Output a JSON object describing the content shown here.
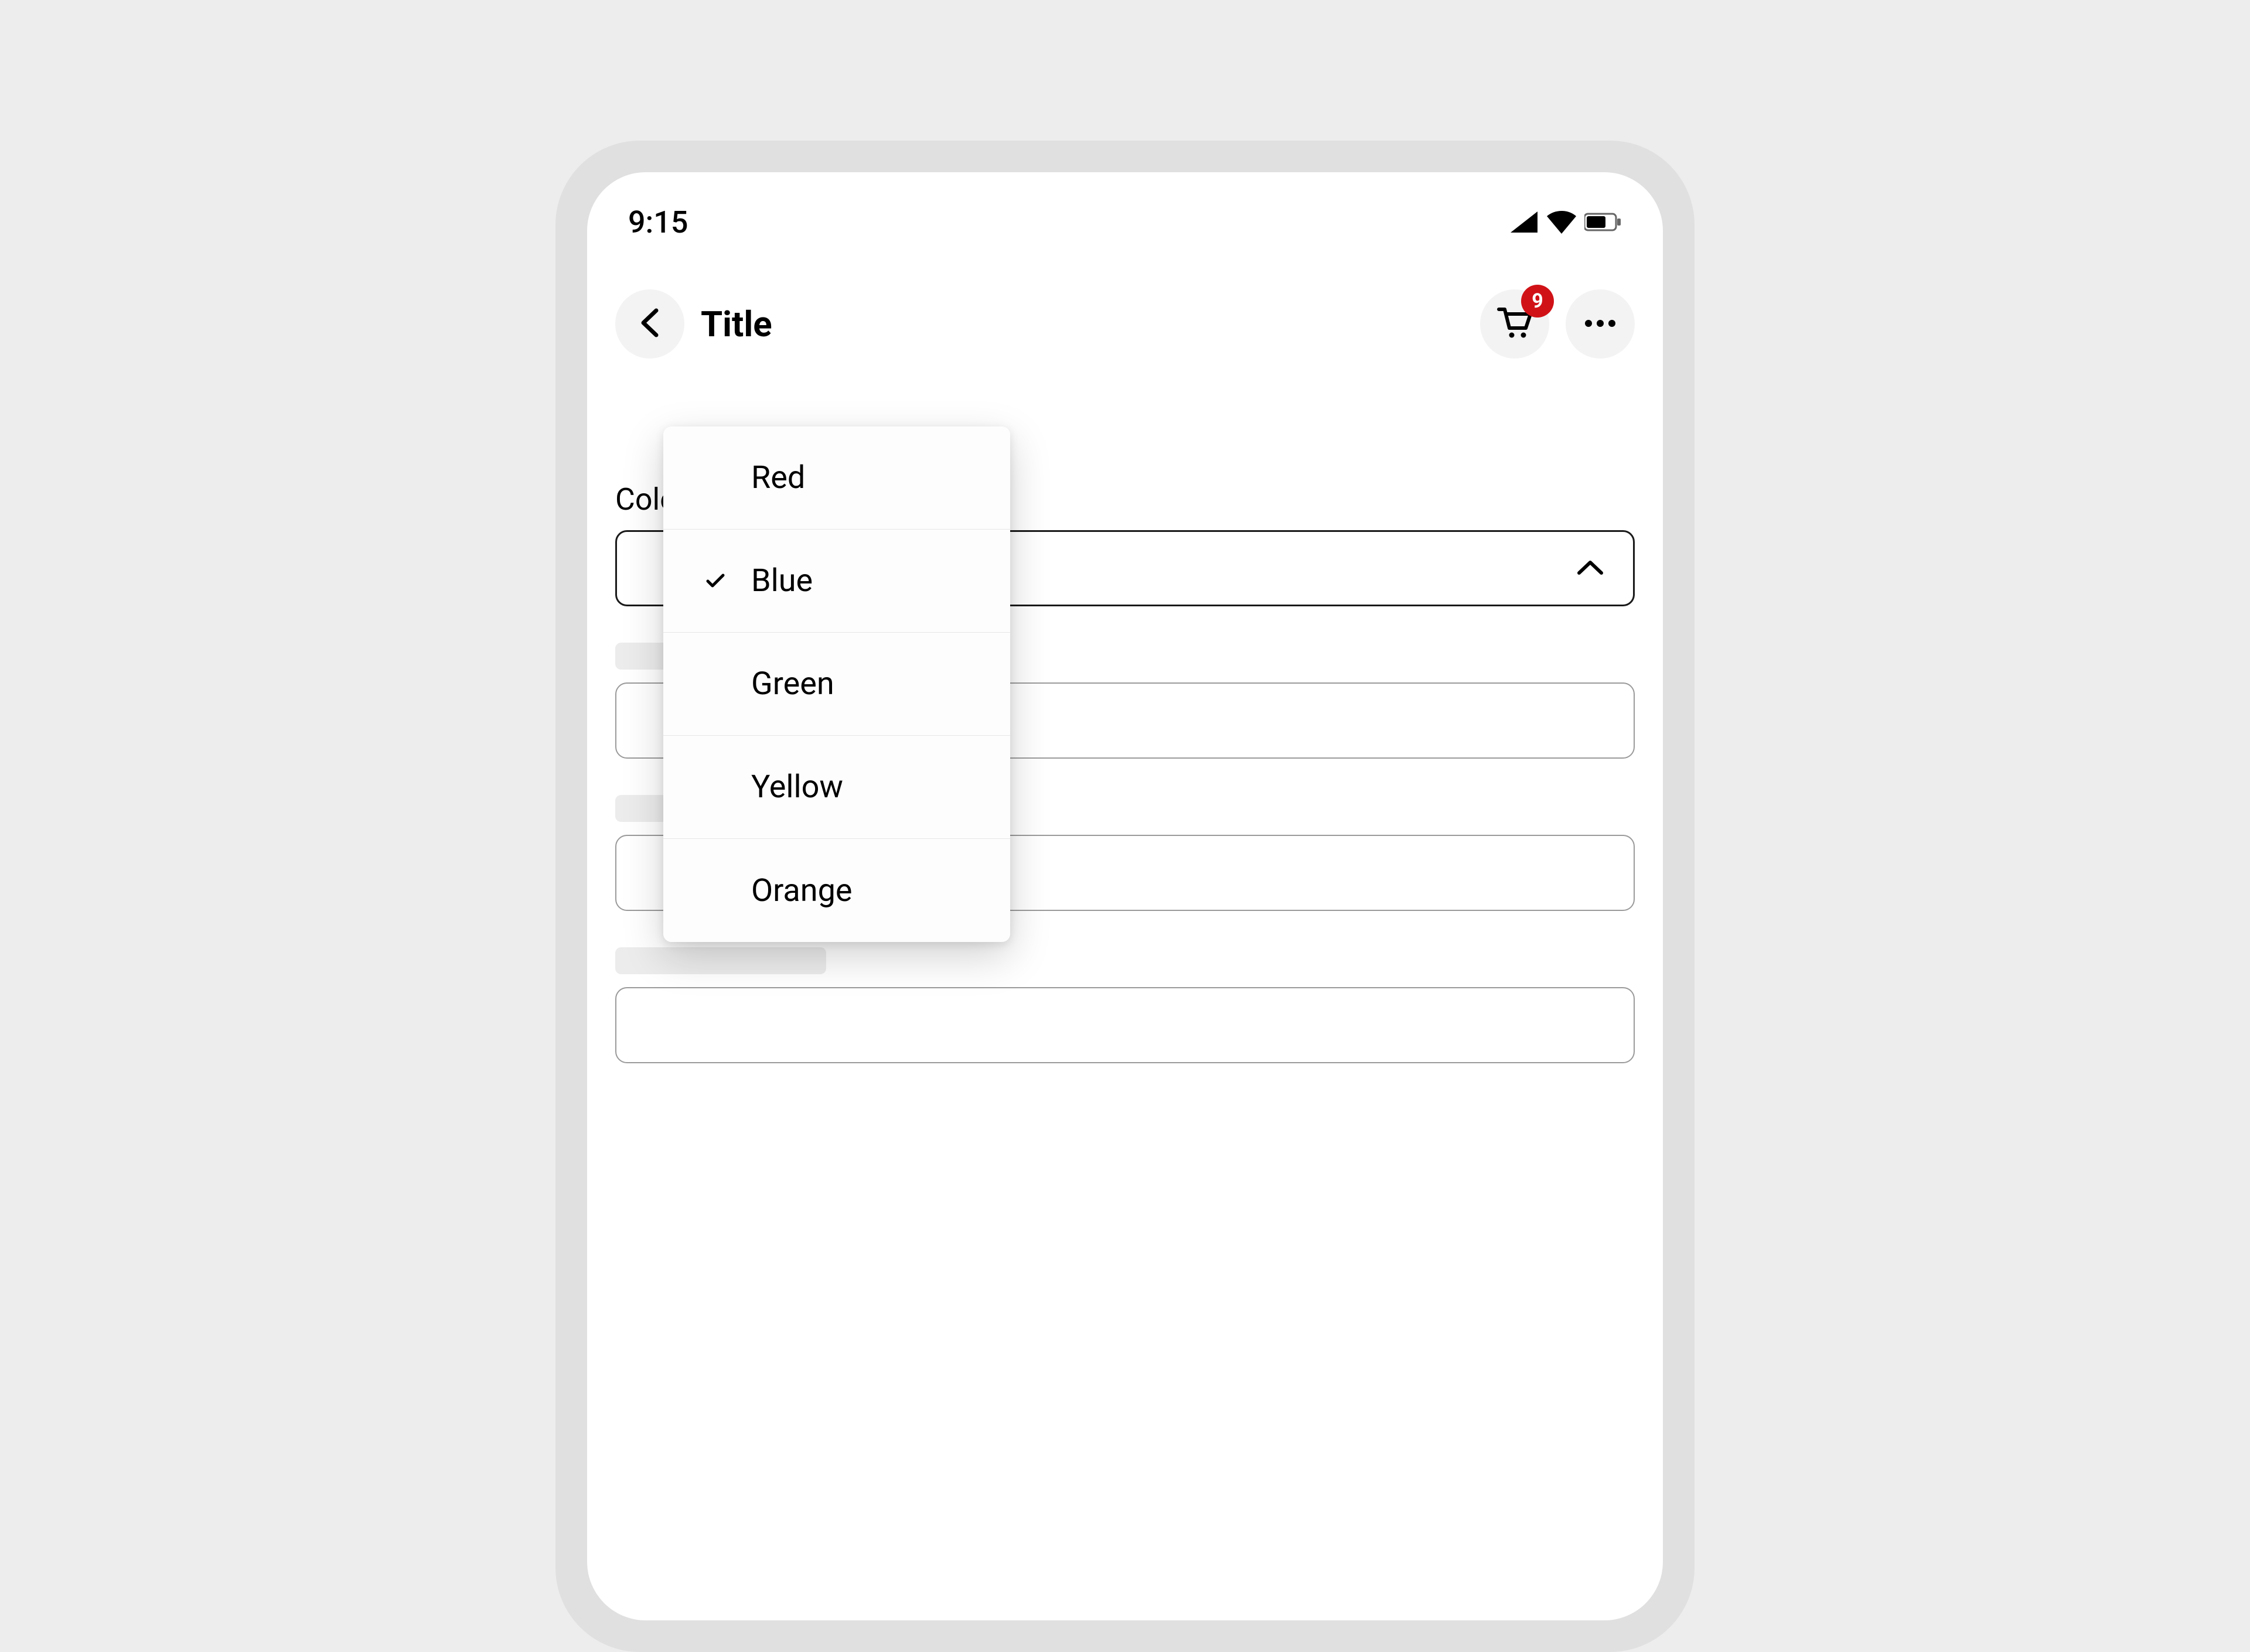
{
  "status": {
    "time": "9:15"
  },
  "header": {
    "title": "Title",
    "cart_badge": "9"
  },
  "form": {
    "color_label": "Color"
  },
  "dropdown": {
    "selected_index": 1,
    "options": [
      "Red",
      "Blue",
      "Green",
      "Yellow",
      "Orange"
    ]
  },
  "colors": {
    "badge": "#d01217"
  }
}
